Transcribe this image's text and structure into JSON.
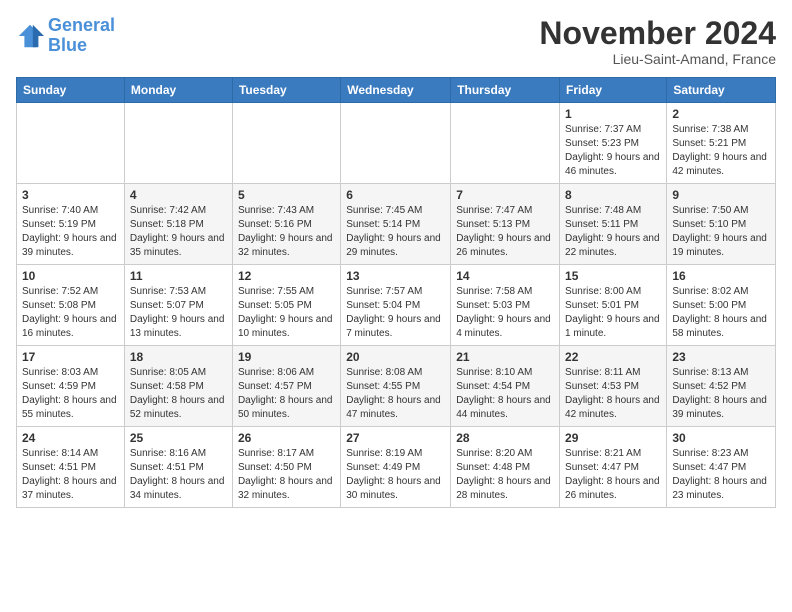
{
  "header": {
    "logo_line1": "General",
    "logo_line2": "Blue",
    "month_title": "November 2024",
    "location": "Lieu-Saint-Amand, France"
  },
  "weekdays": [
    "Sunday",
    "Monday",
    "Tuesday",
    "Wednesday",
    "Thursday",
    "Friday",
    "Saturday"
  ],
  "weeks": [
    [
      {
        "day": "",
        "info": ""
      },
      {
        "day": "",
        "info": ""
      },
      {
        "day": "",
        "info": ""
      },
      {
        "day": "",
        "info": ""
      },
      {
        "day": "",
        "info": ""
      },
      {
        "day": "1",
        "info": "Sunrise: 7:37 AM\nSunset: 5:23 PM\nDaylight: 9 hours and 46 minutes."
      },
      {
        "day": "2",
        "info": "Sunrise: 7:38 AM\nSunset: 5:21 PM\nDaylight: 9 hours and 42 minutes."
      }
    ],
    [
      {
        "day": "3",
        "info": "Sunrise: 7:40 AM\nSunset: 5:19 PM\nDaylight: 9 hours and 39 minutes."
      },
      {
        "day": "4",
        "info": "Sunrise: 7:42 AM\nSunset: 5:18 PM\nDaylight: 9 hours and 35 minutes."
      },
      {
        "day": "5",
        "info": "Sunrise: 7:43 AM\nSunset: 5:16 PM\nDaylight: 9 hours and 32 minutes."
      },
      {
        "day": "6",
        "info": "Sunrise: 7:45 AM\nSunset: 5:14 PM\nDaylight: 9 hours and 29 minutes."
      },
      {
        "day": "7",
        "info": "Sunrise: 7:47 AM\nSunset: 5:13 PM\nDaylight: 9 hours and 26 minutes."
      },
      {
        "day": "8",
        "info": "Sunrise: 7:48 AM\nSunset: 5:11 PM\nDaylight: 9 hours and 22 minutes."
      },
      {
        "day": "9",
        "info": "Sunrise: 7:50 AM\nSunset: 5:10 PM\nDaylight: 9 hours and 19 minutes."
      }
    ],
    [
      {
        "day": "10",
        "info": "Sunrise: 7:52 AM\nSunset: 5:08 PM\nDaylight: 9 hours and 16 minutes."
      },
      {
        "day": "11",
        "info": "Sunrise: 7:53 AM\nSunset: 5:07 PM\nDaylight: 9 hours and 13 minutes."
      },
      {
        "day": "12",
        "info": "Sunrise: 7:55 AM\nSunset: 5:05 PM\nDaylight: 9 hours and 10 minutes."
      },
      {
        "day": "13",
        "info": "Sunrise: 7:57 AM\nSunset: 5:04 PM\nDaylight: 9 hours and 7 minutes."
      },
      {
        "day": "14",
        "info": "Sunrise: 7:58 AM\nSunset: 5:03 PM\nDaylight: 9 hours and 4 minutes."
      },
      {
        "day": "15",
        "info": "Sunrise: 8:00 AM\nSunset: 5:01 PM\nDaylight: 9 hours and 1 minute."
      },
      {
        "day": "16",
        "info": "Sunrise: 8:02 AM\nSunset: 5:00 PM\nDaylight: 8 hours and 58 minutes."
      }
    ],
    [
      {
        "day": "17",
        "info": "Sunrise: 8:03 AM\nSunset: 4:59 PM\nDaylight: 8 hours and 55 minutes."
      },
      {
        "day": "18",
        "info": "Sunrise: 8:05 AM\nSunset: 4:58 PM\nDaylight: 8 hours and 52 minutes."
      },
      {
        "day": "19",
        "info": "Sunrise: 8:06 AM\nSunset: 4:57 PM\nDaylight: 8 hours and 50 minutes."
      },
      {
        "day": "20",
        "info": "Sunrise: 8:08 AM\nSunset: 4:55 PM\nDaylight: 8 hours and 47 minutes."
      },
      {
        "day": "21",
        "info": "Sunrise: 8:10 AM\nSunset: 4:54 PM\nDaylight: 8 hours and 44 minutes."
      },
      {
        "day": "22",
        "info": "Sunrise: 8:11 AM\nSunset: 4:53 PM\nDaylight: 8 hours and 42 minutes."
      },
      {
        "day": "23",
        "info": "Sunrise: 8:13 AM\nSunset: 4:52 PM\nDaylight: 8 hours and 39 minutes."
      }
    ],
    [
      {
        "day": "24",
        "info": "Sunrise: 8:14 AM\nSunset: 4:51 PM\nDaylight: 8 hours and 37 minutes."
      },
      {
        "day": "25",
        "info": "Sunrise: 8:16 AM\nSunset: 4:51 PM\nDaylight: 8 hours and 34 minutes."
      },
      {
        "day": "26",
        "info": "Sunrise: 8:17 AM\nSunset: 4:50 PM\nDaylight: 8 hours and 32 minutes."
      },
      {
        "day": "27",
        "info": "Sunrise: 8:19 AM\nSunset: 4:49 PM\nDaylight: 8 hours and 30 minutes."
      },
      {
        "day": "28",
        "info": "Sunrise: 8:20 AM\nSunset: 4:48 PM\nDaylight: 8 hours and 28 minutes."
      },
      {
        "day": "29",
        "info": "Sunrise: 8:21 AM\nSunset: 4:47 PM\nDaylight: 8 hours and 26 minutes."
      },
      {
        "day": "30",
        "info": "Sunrise: 8:23 AM\nSunset: 4:47 PM\nDaylight: 8 hours and 23 minutes."
      }
    ]
  ]
}
